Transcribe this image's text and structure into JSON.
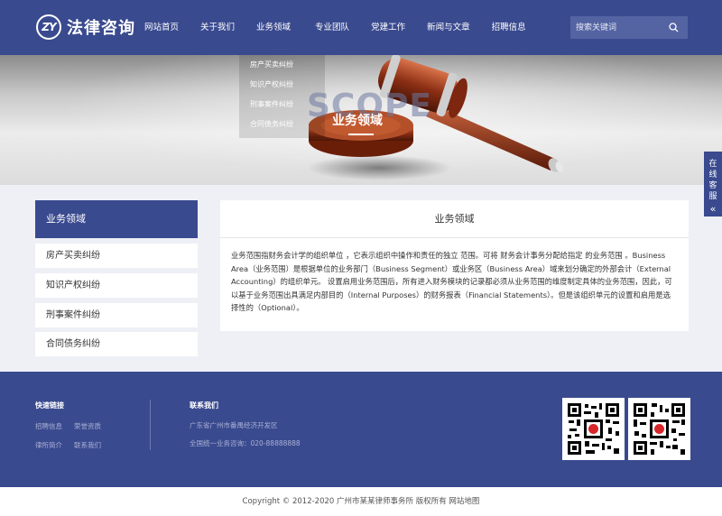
{
  "header": {
    "logo_mark": "ZY",
    "logo_text": "法律咨询",
    "nav": [
      "网站首页",
      "关于我们",
      "业务领域",
      "专业团队",
      "党建工作",
      "新闻与文章",
      "招聘信息"
    ],
    "search_placeholder": "搜索关键词"
  },
  "banner": {
    "dropdown": [
      "房产买卖纠纷",
      "知识产权纠纷",
      "刑事案件纠纷",
      "合同债务纠纷"
    ],
    "english_title": "SCOPE",
    "title": "业务领域"
  },
  "side_float": {
    "chars": [
      "在",
      "线",
      "客",
      "服"
    ],
    "arrow": "«"
  },
  "sidebar": {
    "title": "业务领域",
    "items": [
      "房产买卖纠纷",
      "知识产权纠纷",
      "刑事案件纠纷",
      "合同债务纠纷"
    ]
  },
  "main": {
    "title": "业务领域",
    "body": "业务范围指财务会计学的组织单位 ，它表示组织中操作和责任的独立 范围。可将 财务会计事务分配给指定 的业务范围 。Business Area（业务范围）是根据单位的业务部门（Business Segment）或业务区（Business Area）域来划分确定的外部会计（External Accounting）的组织单元。 设置启用业务范围后，所有进入财务模块的记录都必须从业务范围的维度制定具体的业务范围，因此，可以基于业务范围出具满足内部目的（Internal Purposes）的财务报表（Financial Statements）。但是该组织单元的设置和启用是选择性的（Optional）。"
  },
  "footer": {
    "quick_links_title": "快速链接",
    "quick_links": [
      "招聘信息",
      "荣誉资质",
      "律所简介",
      "联系我们"
    ],
    "contact_title": "联系我们",
    "address": "广东省广州市番禺经济开发区",
    "hotline": "全国统一业务咨询：020-88888888",
    "copyright": "Copyright © 2012-2020 广州市某某律师事务所 版权所有 网站地图"
  },
  "colors": {
    "brand": "#3a4a8f",
    "footer_link": "#a9b1d4"
  }
}
